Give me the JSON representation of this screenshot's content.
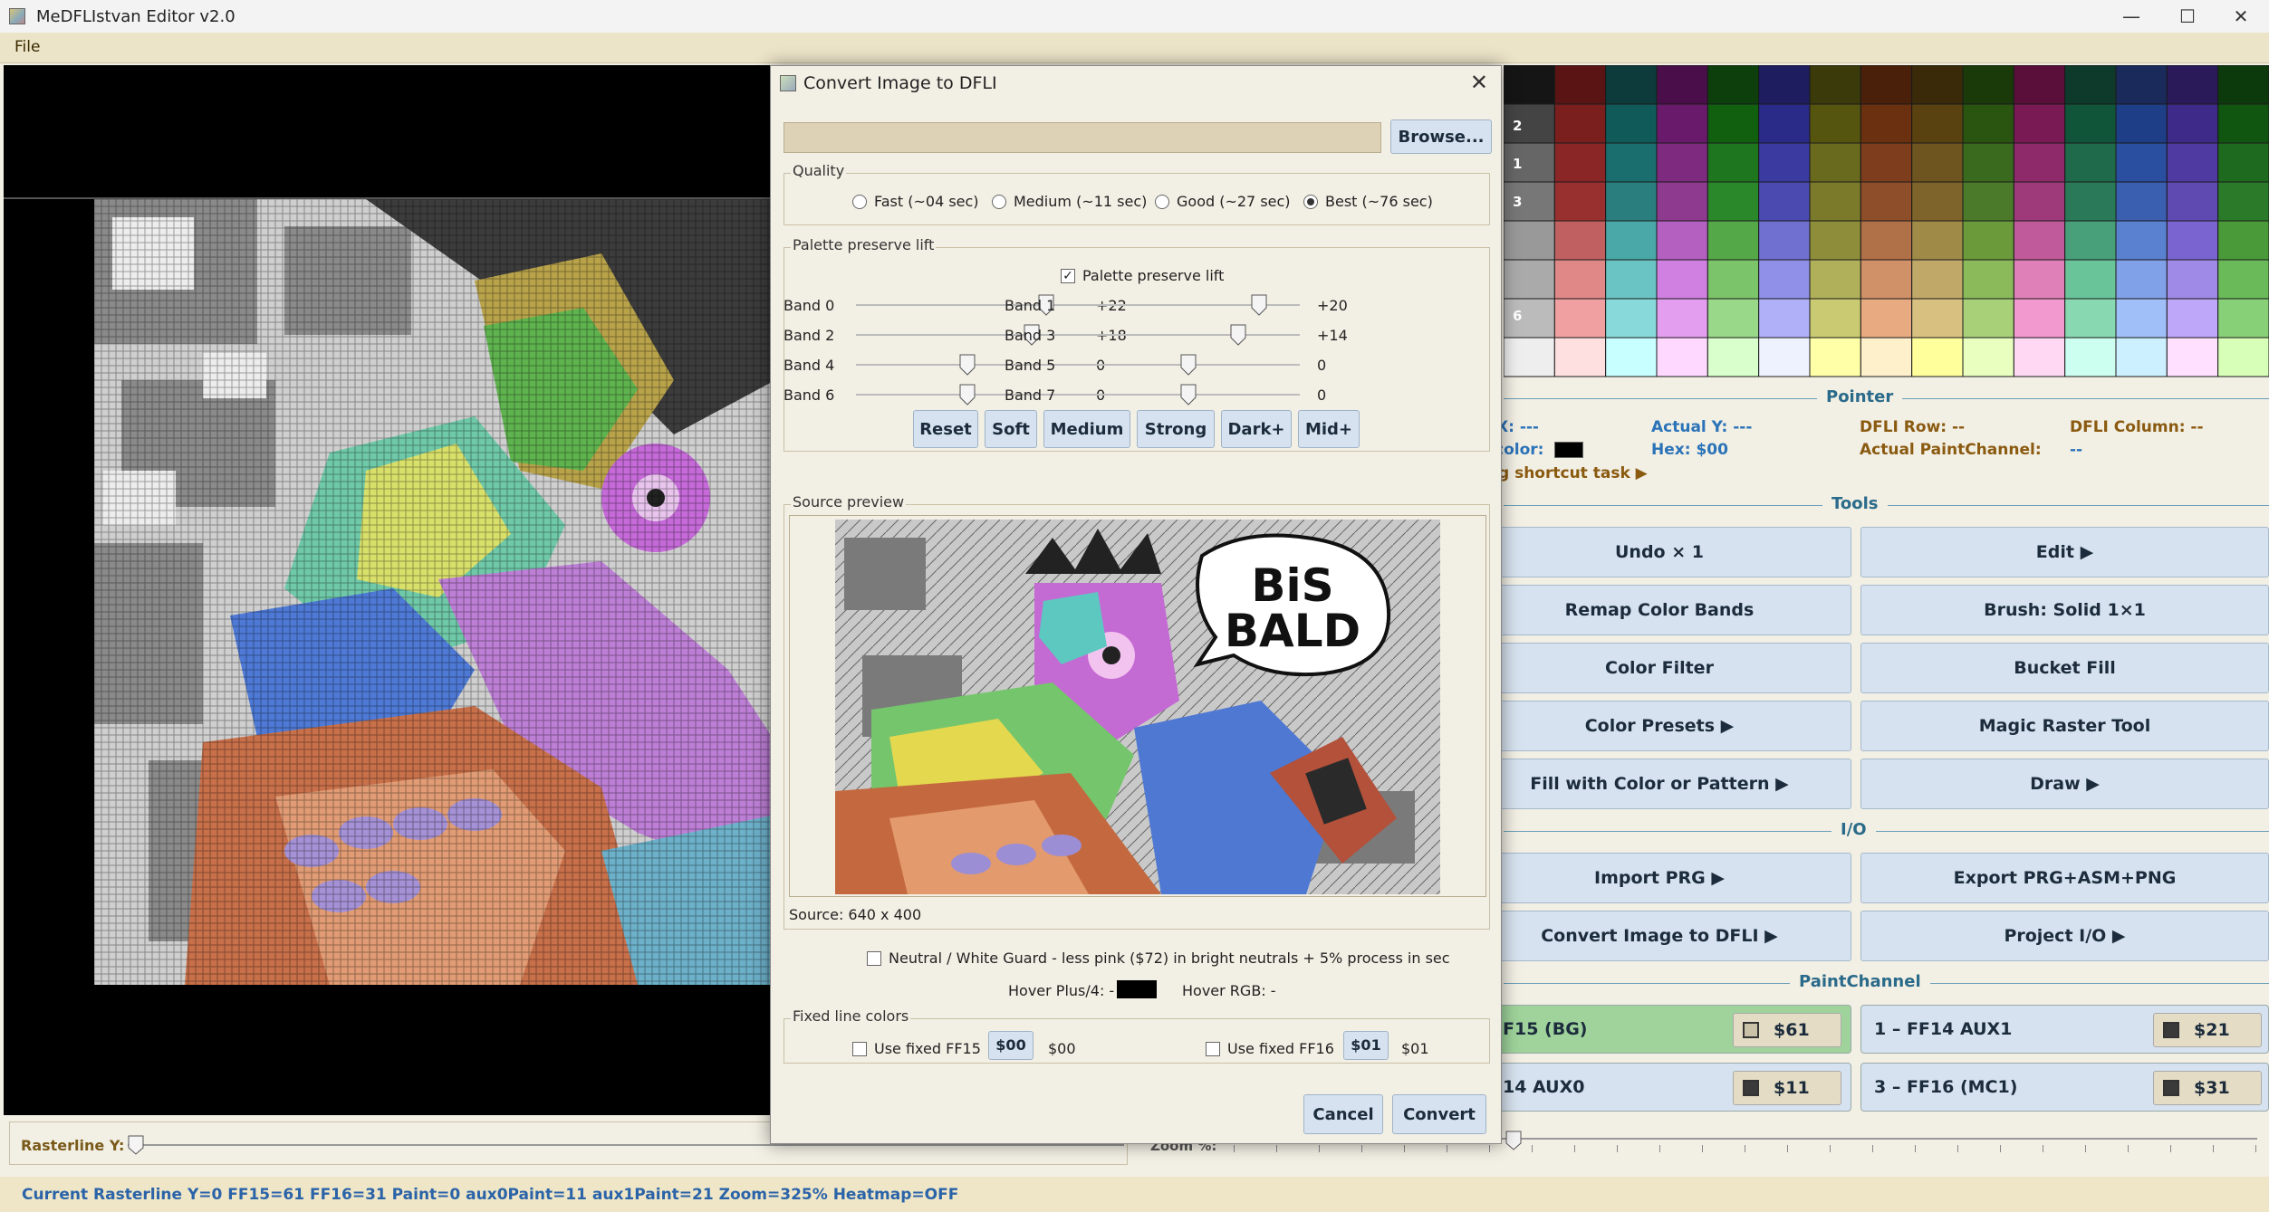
{
  "window": {
    "title": "MeDFLIstvan Editor v2.0",
    "minimize": "—",
    "maximize": "☐",
    "close": "✕"
  },
  "menu": {
    "file": "File"
  },
  "palette": {
    "row_labels": [
      "2",
      "1",
      "3",
      "6"
    ]
  },
  "pointer": {
    "header": "Pointer",
    "x": "X: ---",
    "actual_y": "Actual Y: ---",
    "dfli_row": "DFLI Row: --",
    "dfli_column": "DFLI Column: --",
    "color": "color:",
    "hex": "Hex: $00",
    "actual_paint_channel": "Actual PaintChannel:",
    "actual_paint_channel_value": "--",
    "shortcut": "g shortcut task ▶"
  },
  "tools": {
    "header": "Tools",
    "left": [
      "Undo × 1",
      "Remap Color Bands",
      "Color Filter",
      "Color Presets  ▶",
      "Fill with Color or Pattern  ▶"
    ],
    "right": [
      "Edit  ▶",
      "Brush: Solid 1×1",
      "Bucket Fill",
      "Magic Raster Tool",
      "Draw  ▶"
    ]
  },
  "io": {
    "header": "I/O",
    "left": [
      "Import PRG  ▶",
      "Convert Image to DFLI  ▶"
    ],
    "right": [
      "Export PRG+ASM+PNG",
      "Project I/O  ▶"
    ]
  },
  "paint_channel": {
    "header": "PaintChannel",
    "items": [
      {
        "label": "F15 (BG)",
        "value": "$61",
        "swatch": "#c9c2a8",
        "bg": "#9fd39b"
      },
      {
        "label": "1 – FF14 AUX1",
        "value": "$21",
        "swatch": "#3a3a3a",
        "bg": "#d6e2ef"
      },
      {
        "label": "14 AUX0",
        "value": "$11",
        "swatch": "#3a3a3a",
        "bg": "#d6e2ef"
      },
      {
        "label": "3 – FF16 (MC1)",
        "value": "$31",
        "swatch": "#3a3a3a",
        "bg": "#d6e2ef"
      }
    ]
  },
  "raster": {
    "label": "Rasterline Y:"
  },
  "zoom": {
    "label": "Zoom %:"
  },
  "status": "Current Rasterline Y=0  FF15=61  FF16=31  Paint=0  aux0Paint=11  aux1Paint=21  Zoom=325%  Heatmap=OFF",
  "dialog": {
    "title": "Convert Image to DFLI",
    "browse": "Browse...",
    "quality": {
      "label": "Quality",
      "options": [
        {
          "label": "Fast (~04 sec)",
          "selected": false
        },
        {
          "label": "Medium (~11 sec)",
          "selected": false
        },
        {
          "label": "Good (~27 sec)",
          "selected": false
        },
        {
          "label": "Best (~76 sec)",
          "selected": true
        }
      ]
    },
    "lift": {
      "label": "Palette preserve lift",
      "checkbox_label": "Palette preserve lift",
      "checkbox_checked": true,
      "bands": [
        {
          "name": "Band 0",
          "value": "+22",
          "level": 0.88
        },
        {
          "name": "Band 1",
          "value": "+20",
          "level": 0.84
        },
        {
          "name": "Band 2",
          "value": "+18",
          "level": 0.81
        },
        {
          "name": "Band 3",
          "value": "+14",
          "level": 0.74
        },
        {
          "name": "Band 4",
          "value": "0",
          "level": 0.5
        },
        {
          "name": "Band 5",
          "value": "0",
          "level": 0.5
        },
        {
          "name": "Band 6",
          "value": "0",
          "level": 0.5
        },
        {
          "name": "Band 7",
          "value": "0",
          "level": 0.5
        }
      ],
      "presets": [
        "Reset",
        "Soft",
        "Medium",
        "Strong",
        "Dark+",
        "Mid+"
      ]
    },
    "preview": {
      "label": "Source preview",
      "source": "Source: 640 x 400",
      "bubble_line1": "BiS",
      "bubble_line2": "BALD"
    },
    "guard": "Neutral / White Guard - less pink ($72) in bright neutrals + 5% process in sec",
    "hover_plus": "Hover Plus/4: -",
    "hover_rgb": "Hover RGB: -",
    "fixed": {
      "label": "Fixed line colors",
      "ff15_label": "Use fixed FF15",
      "ff15_btn": "$00",
      "ff15_val": "$00",
      "ff16_label": "Use fixed FF16",
      "ff16_btn": "$01",
      "ff16_val": "$01"
    },
    "cancel": "Cancel",
    "convert": "Convert"
  }
}
